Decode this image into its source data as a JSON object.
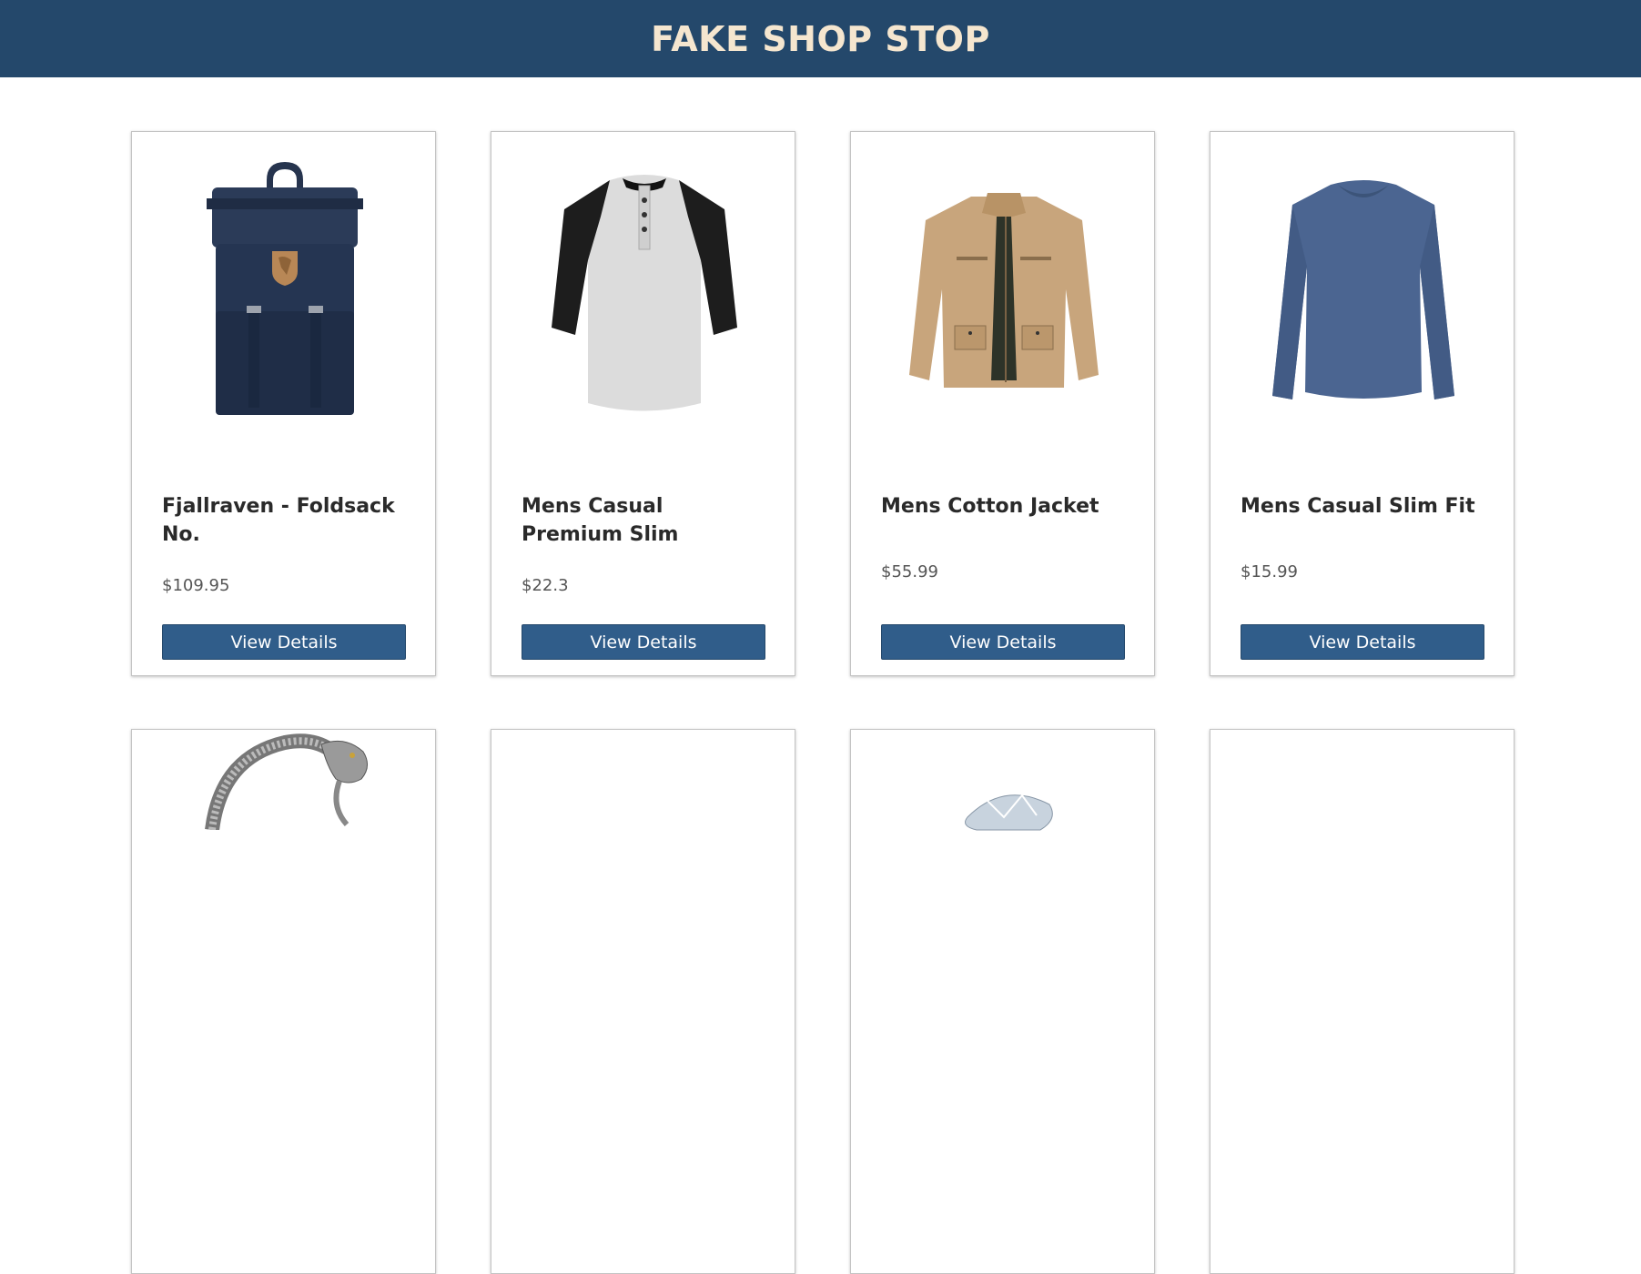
{
  "header": {
    "title": "FAKE SHOP STOP"
  },
  "products": [
    {
      "title": "Fjallraven - Foldsack No.",
      "price": "$109.95",
      "button_label": "View Details",
      "image": "backpack-image"
    },
    {
      "title": "Mens Casual Premium Slim",
      "price": "$22.3",
      "button_label": "View Details",
      "image": "raglan-henley-shirt-image"
    },
    {
      "title": "Mens Cotton Jacket",
      "price": "$55.99",
      "button_label": "View Details",
      "image": "cotton-jacket-image"
    },
    {
      "title": "Mens Casual Slim Fit",
      "price": "$15.99",
      "button_label": "View Details",
      "image": "long-sleeve-shirt-image"
    }
  ],
  "second_row_images": [
    "bracelet-image",
    "",
    "ring-image",
    ""
  ],
  "colors": {
    "header_bg": "#24486b",
    "header_text": "#f5e6cf",
    "button_bg": "#305d8a",
    "button_text": "#ffffff"
  }
}
